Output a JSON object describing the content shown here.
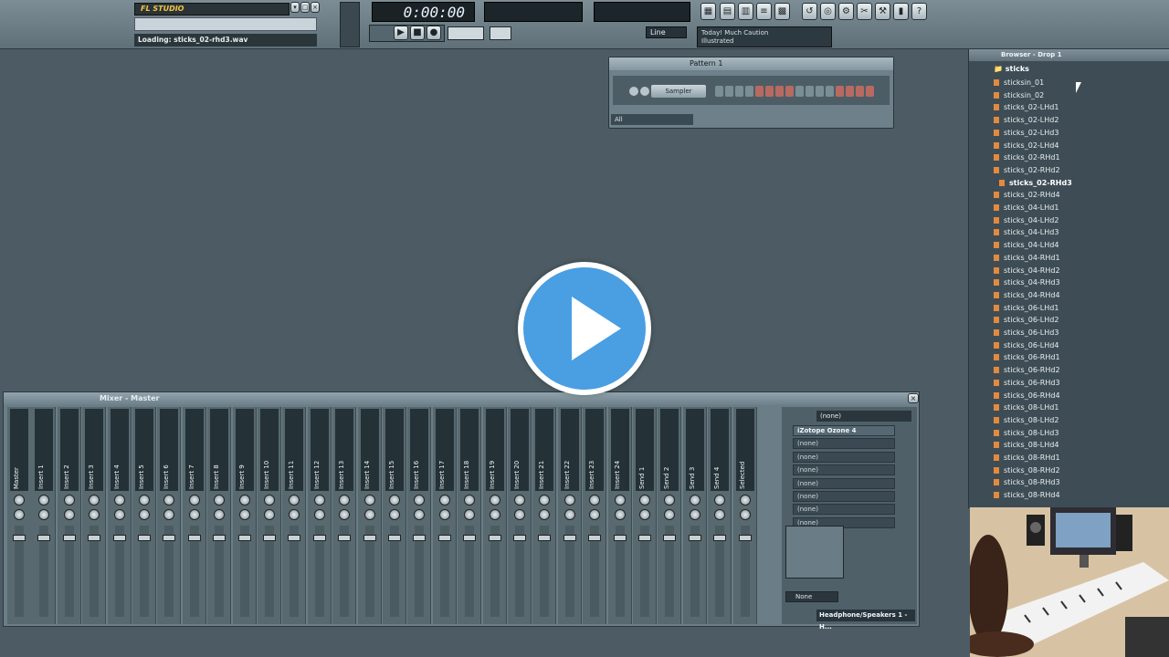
{
  "toolbar": {
    "logo": "FL STUDIO",
    "hint": "",
    "loading": "Loading: sticks_02-rhd3.wav",
    "time": "0:00:00",
    "snap": "Line",
    "preset_line1": "Today! Much Caution",
    "preset_line2": "Illustrated"
  },
  "channel_rack": {
    "title": "Pattern 1",
    "instrument": "Sampler",
    "filter": "All",
    "step_colors": [
      "#c26a5f",
      "#6d8790",
      "#c26a5f",
      "#6d8790"
    ]
  },
  "browser": {
    "title": "Browser - Drop 1",
    "folder": "sticks",
    "items": [
      "sticksin_01",
      "sticksin_02",
      "sticks_02-LHd1",
      "sticks_02-LHd2",
      "sticks_02-LHd3",
      "sticks_02-LHd4",
      "sticks_02-RHd1",
      "sticks_02-RHd2",
      "sticks_02-RHd3",
      "sticks_02-RHd4",
      "sticks_04-LHd1",
      "sticks_04-LHd2",
      "sticks_04-LHd3",
      "sticks_04-LHd4",
      "sticks_04-RHd1",
      "sticks_04-RHd2",
      "sticks_04-RHd3",
      "sticks_04-RHd4",
      "sticks_06-LHd1",
      "sticks_06-LHd2",
      "sticks_06-LHd3",
      "sticks_06-LHd4",
      "sticks_06-RHd1",
      "sticks_06-RHd2",
      "sticks_06-RHd3",
      "sticks_06-RHd4",
      "sticks_08-LHd1",
      "sticks_08-LHd2",
      "sticks_08-LHd3",
      "sticks_08-LHd4",
      "sticks_08-RHd1",
      "sticks_08-RHd2",
      "sticks_08-RHd3",
      "sticks_08-RHd4"
    ],
    "selected_index": 8
  },
  "mixer": {
    "title": "Mixer - Master",
    "channels": [
      "Master",
      "Insert 1",
      "Insert 2",
      "Insert 3",
      "Insert 4",
      "Insert 5",
      "Insert 6",
      "Insert 7",
      "Insert 8",
      "Insert 9",
      "Insert 10",
      "Insert 11",
      "Insert 12",
      "Insert 13",
      "Insert 14",
      "Insert 15",
      "Insert 16",
      "Insert 17",
      "Insert 18",
      "Insert 19",
      "Insert 20",
      "Insert 21",
      "Insert 22",
      "Insert 23",
      "Insert 24",
      "Send 1",
      "Send 2",
      "Send 3",
      "Send 4",
      "Selected"
    ],
    "input": "(none)",
    "fx_slots": [
      "iZotope Ozone 4",
      "(none)",
      "(none)",
      "(none)",
      "(none)",
      "(none)",
      "(none)",
      "(none)"
    ],
    "output": "Headphone/Speakers 1 - H...",
    "none_label": "None"
  },
  "overlay": {
    "play_icon": "play-icon"
  }
}
